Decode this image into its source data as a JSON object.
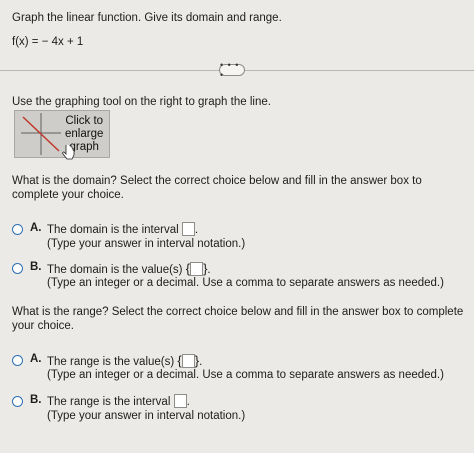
{
  "problem": {
    "instruction": "Graph the linear function. Give its domain and range.",
    "function": "f(x) = − 4x + 1"
  },
  "more_button": {
    "label": "• • • •"
  },
  "graph_prompt": "Use the graphing tool on the right to graph the line.",
  "graph_button": {
    "label": "Click to\nenlarge\ngraph"
  },
  "domain": {
    "question": "What is the domain? Select the correct choice below and fill in the answer box to complete your choice.",
    "options": [
      {
        "letter": "A.",
        "text": "The domain is the interval",
        "suffix": ".",
        "note": "(Type your answer in interval notation.)"
      },
      {
        "letter": "B.",
        "text": "The domain is the value(s)",
        "brace_open": "{",
        "brace_close": "}",
        "suffix": ".",
        "note": "(Type an integer or a decimal. Use a comma to separate answers as needed.)"
      }
    ]
  },
  "range": {
    "question": "What is the range? Select the correct choice below and fill in the answer box to complete your choice.",
    "options": [
      {
        "letter": "A.",
        "text": "The range is the value(s)",
        "brace_open": "{",
        "brace_close": "}",
        "suffix": ".",
        "note": "(Type an integer or a decimal. Use a comma to separate answers as needed.)"
      },
      {
        "letter": "B.",
        "text": "The range is the interval",
        "suffix": ".",
        "note": "(Type your answer in interval notation.)"
      }
    ]
  },
  "colors": {
    "radio": "#2e6fb3",
    "background": "#eceae6"
  }
}
